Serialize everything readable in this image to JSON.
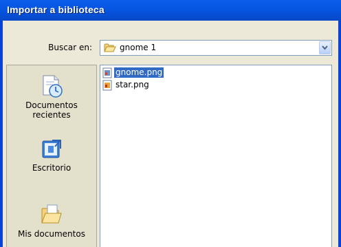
{
  "window": {
    "title": "Importar a biblioteca"
  },
  "lookin": {
    "label": "Buscar en:",
    "value": "gnome 1",
    "folder_icon": "folder-icon"
  },
  "places": [
    {
      "id": "recent",
      "label_line1": "Documentos",
      "label_line2": "recientes",
      "icon": "recent-documents-icon"
    },
    {
      "id": "desktop",
      "label_line1": "Escritorio",
      "label_line2": "",
      "icon": "desktop-icon"
    },
    {
      "id": "mydocs",
      "label_line1": "Mis documentos",
      "label_line2": "",
      "icon": "my-documents-icon"
    }
  ],
  "files": [
    {
      "name": "gnome.png",
      "selected": true,
      "icon": "png-file-icon"
    },
    {
      "name": "star.png",
      "selected": false,
      "icon": "png-file-icon"
    }
  ],
  "colors": {
    "title_bar": "#0653de",
    "selection": "#316ac5",
    "dialog_bg": "#ece9d8"
  }
}
